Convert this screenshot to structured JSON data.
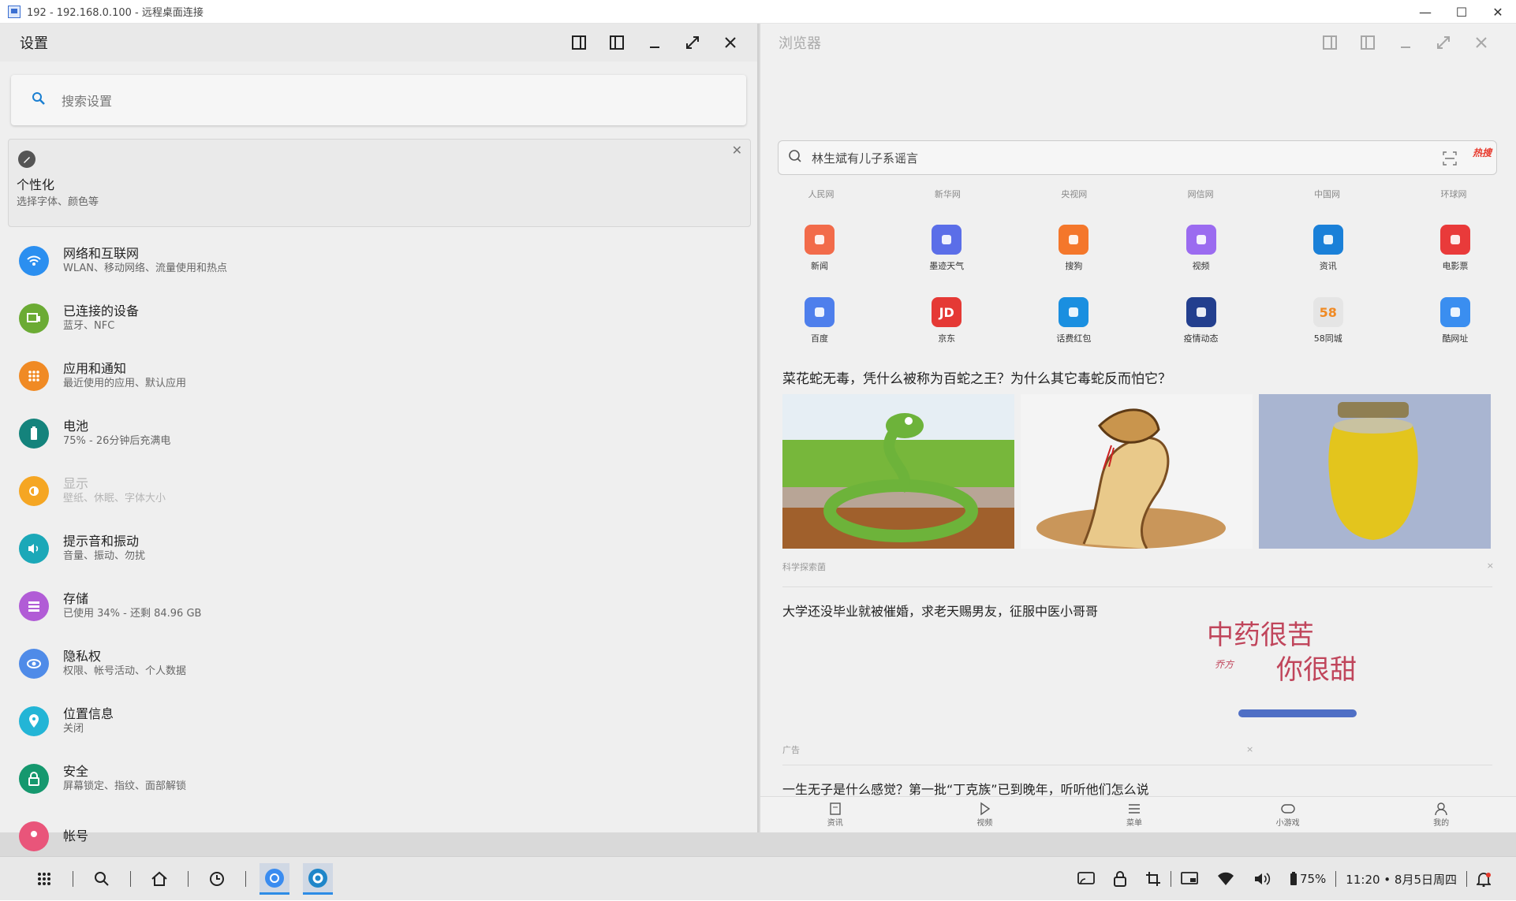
{
  "rdp": {
    "title": "192 - 192.168.0.100 - 远程桌面连接"
  },
  "settings": {
    "title": "设置",
    "search_placeholder": "搜索设置",
    "suggestion": {
      "title": "个性化",
      "subtitle": "选择字体、颜色等"
    },
    "items": [
      {
        "title": "网络和互联网",
        "subtitle": "WLAN、移动网络、流量使用和热点",
        "icon": "wifi-icon",
        "color": "#2b8ff0"
      },
      {
        "title": "已连接的设备",
        "subtitle": "蓝牙、NFC",
        "icon": "devices-icon",
        "color": "#6bab34"
      },
      {
        "title": "应用和通知",
        "subtitle": "最近使用的应用、默认应用",
        "icon": "apps-icon",
        "color": "#f08a24"
      },
      {
        "title": "电池",
        "subtitle": "75% - 26分钟后充满电",
        "icon": "battery-icon",
        "color": "#14837c"
      },
      {
        "title": "显示",
        "subtitle": "壁纸、休眠、字体大小",
        "icon": "display-icon",
        "color": "#f5a623"
      },
      {
        "title": "提示音和振动",
        "subtitle": "音量、振动、勿扰",
        "icon": "sound-icon",
        "color": "#1ba8b8"
      },
      {
        "title": "存储",
        "subtitle": "已使用 34% - 还剩 84.96 GB",
        "icon": "storage-icon",
        "color": "#b15cd6"
      },
      {
        "title": "隐私权",
        "subtitle": "权限、帐号活动、个人数据",
        "icon": "privacy-icon",
        "color": "#4f8be8"
      },
      {
        "title": "位置信息",
        "subtitle": "关闭",
        "icon": "location-icon",
        "color": "#23b5d6"
      },
      {
        "title": "安全",
        "subtitle": "屏幕锁定、指纹、面部解锁",
        "icon": "lock-icon",
        "color": "#15986e"
      },
      {
        "title": "帐号",
        "subtitle": "",
        "icon": "account-icon",
        "color": "#e9557a"
      }
    ]
  },
  "browser": {
    "title": "浏览器",
    "search_text": "林生斌有儿子系谣言",
    "hot_label": "热搜",
    "portals": [
      "人民网",
      "新华网",
      "央视网",
      "网信网",
      "中国网",
      "环球网"
    ],
    "apps_row1": [
      {
        "label": "新闻",
        "icon": "news-icon",
        "color": "#f26b4a"
      },
      {
        "label": "墨迹天气",
        "icon": "weather-icon",
        "color": "#5b6ee8"
      },
      {
        "label": "搜狗",
        "icon": "sogou-icon",
        "color": "#f4772b"
      },
      {
        "label": "视频",
        "icon": "video-icon",
        "color": "#9b6bf0"
      },
      {
        "label": "资讯",
        "icon": "info-icon",
        "color": "#1a80d8"
      },
      {
        "label": "电影票",
        "icon": "movie-icon",
        "color": "#e93a3a"
      }
    ],
    "apps_row2": [
      {
        "label": "百度",
        "icon": "baidu-icon",
        "color": "#4e7fec"
      },
      {
        "label": "京东",
        "icon": "jd-icon",
        "color": "#e53935"
      },
      {
        "label": "话费红包",
        "icon": "phone-bill-icon",
        "color": "#1a8fe0"
      },
      {
        "label": "疫情动态",
        "icon": "epidemic-icon",
        "color": "#233f8e"
      },
      {
        "label": "58同城",
        "icon": "58-icon",
        "color": "#e5e5e5"
      },
      {
        "label": "酷网址",
        "icon": "compass-icon",
        "color": "#3a8ef0"
      }
    ],
    "jd_text": "JD",
    "fiftyeight_text": "58",
    "news1": {
      "title": "菜花蛇无毒，凭什么被称为百蛇之王？为什么其它毒蛇反而怕它？",
      "source": "科学探索菌",
      "close": "×"
    },
    "news2": {
      "title": "大学还没毕业就被催婚，求老天赐男友，征服中医小哥哥",
      "ad_label": "广告",
      "close": "×",
      "ad_line1": "中药很苦",
      "ad_line2": "你很甜",
      "ad_small": "乔方"
    },
    "news3": {
      "title": "一生无子是什么感觉？第一批“丁克族”已到晚年，听听他们怎么说"
    },
    "nav": [
      "资讯",
      "视频",
      "菜单",
      "小游戏",
      "我的"
    ]
  },
  "taskbar": {
    "battery": "75%",
    "clock": "11:20 • 8月5日周四"
  }
}
